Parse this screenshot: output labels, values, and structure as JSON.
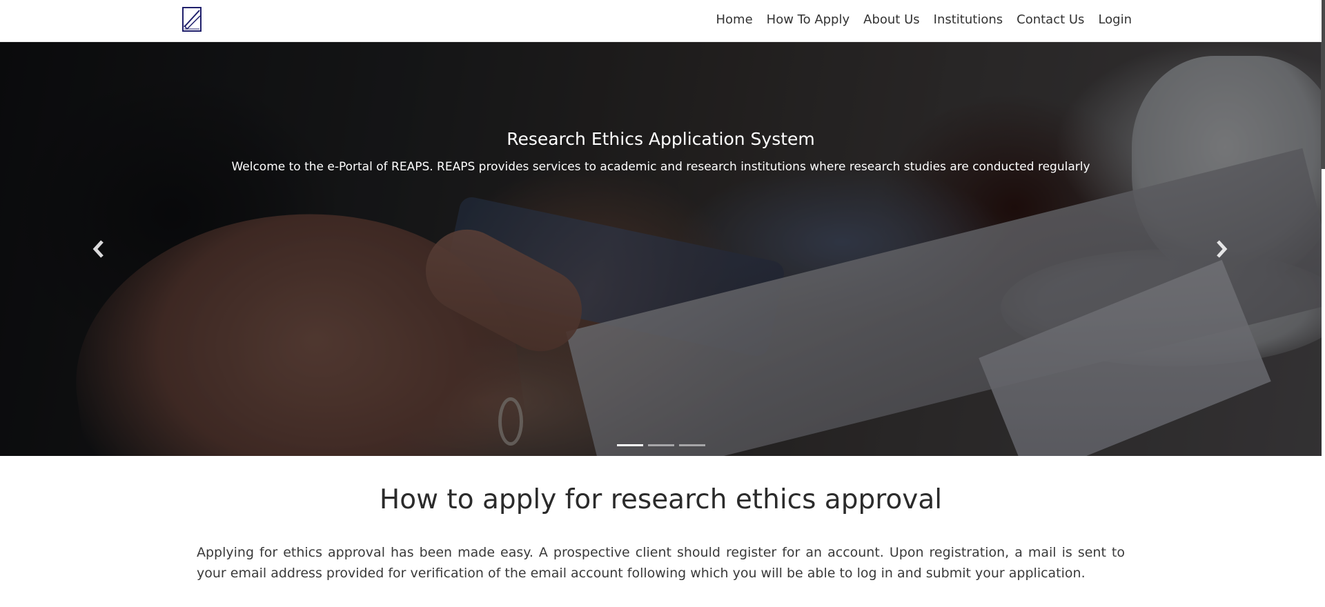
{
  "navbar": {
    "logo_icon": "checkbox-document-logo-icon",
    "links": [
      {
        "label": "Home"
      },
      {
        "label": "How To Apply"
      },
      {
        "label": "About Us"
      },
      {
        "label": "Institutions"
      },
      {
        "label": "Contact Us"
      },
      {
        "label": "Login"
      }
    ]
  },
  "hero": {
    "title": "Research Ethics Application System",
    "subtitle": "Welcome to the e-Portal of REAPS. REAPS provides services to academic and research institutions where research studies are conducted regularly",
    "prev_icon": "chevron-left-icon",
    "next_icon": "chevron-right-icon",
    "slide_count": 3,
    "active_slide": 1
  },
  "content": {
    "title": "How to apply for research ethics approval",
    "body": "Applying for ethics approval has been made easy. A prospective client should register for an account. Upon registration, a mail is sent to your email address provided for verification of the email account following which you will be able to log in and submit your application."
  },
  "colors": {
    "logo_stroke": "#1f1f6b",
    "nav_text": "#333333",
    "hero_overlay": "rgba(0,0,0,0.45)"
  }
}
